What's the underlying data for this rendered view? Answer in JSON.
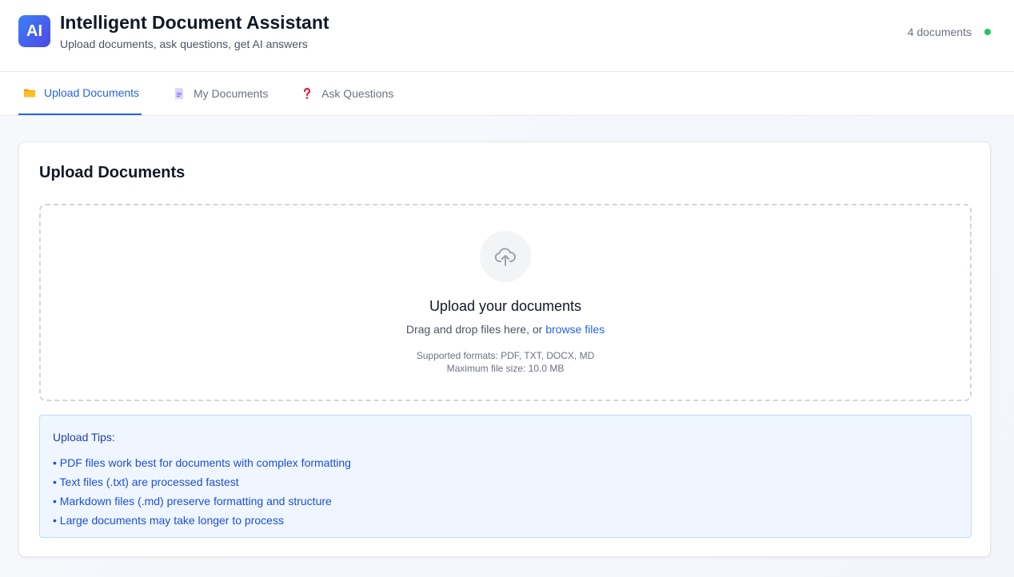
{
  "header": {
    "logo_text": "AI",
    "title": "Intelligent Document Assistant",
    "subtitle": "Upload documents, ask questions, get AI answers",
    "doc_count": "4 documents",
    "status_color": "#22c55e"
  },
  "tabs": [
    {
      "label": "Upload Documents",
      "icon": "folder-icon",
      "active": true
    },
    {
      "label": "My Documents",
      "icon": "document-icon",
      "active": false
    },
    {
      "label": "Ask Questions",
      "icon": "question-mark-icon",
      "active": false
    }
  ],
  "upload": {
    "title": "Upload Documents",
    "dropzone": {
      "icon": "cloud-upload-icon",
      "heading": "Upload your documents",
      "instruction_prefix": "Drag and drop files here, or ",
      "browse_link": "browse files",
      "formats": "Supported formats: PDF, TXT, DOCX, MD",
      "max_size": "Maximum file size: 10.0 MB"
    },
    "tips": {
      "title": "Upload Tips:",
      "items": [
        "• PDF files work best for documents with complex formatting",
        "• Text files (.txt) are processed fastest",
        "• Markdown files (.md) preserve formatting and structure",
        "• Large documents may take longer to process"
      ]
    }
  },
  "colors": {
    "accent": "#2563eb",
    "tips_background": "#eff6ff",
    "tips_text": "#1d4ed8"
  }
}
